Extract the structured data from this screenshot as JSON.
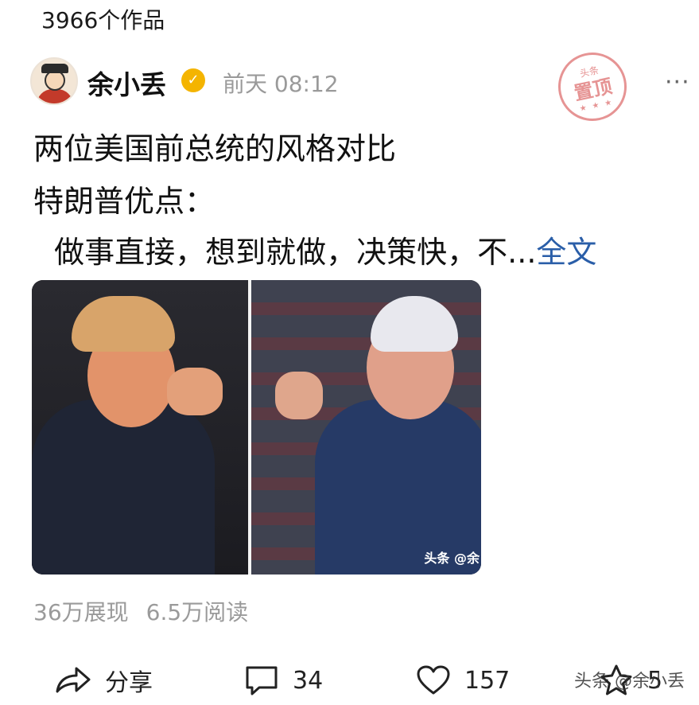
{
  "profile": {
    "works_count": "3966个作品"
  },
  "post": {
    "author": "余小丢",
    "time": "前天  08:12",
    "pinned_stamp": {
      "top": "头条",
      "main": "置顶"
    },
    "lines": [
      "两位美国前总统的风格对比",
      "特朗普优点：",
      "  做事直接，想到就做，决策快，不..."
    ],
    "full_text_link": "全文",
    "image_watermark": "头条 @余",
    "stats": {
      "views": "36万展现",
      "reads": "6.5万阅读"
    }
  },
  "actions": {
    "share": "分享",
    "comments": "34",
    "likes": "157",
    "favorites": "5"
  },
  "watermark": "头条 @余小丢",
  "icons": [
    "verified-badge-icon",
    "more-icon",
    "share-icon",
    "comment-icon",
    "like-icon",
    "favorite-icon"
  ]
}
